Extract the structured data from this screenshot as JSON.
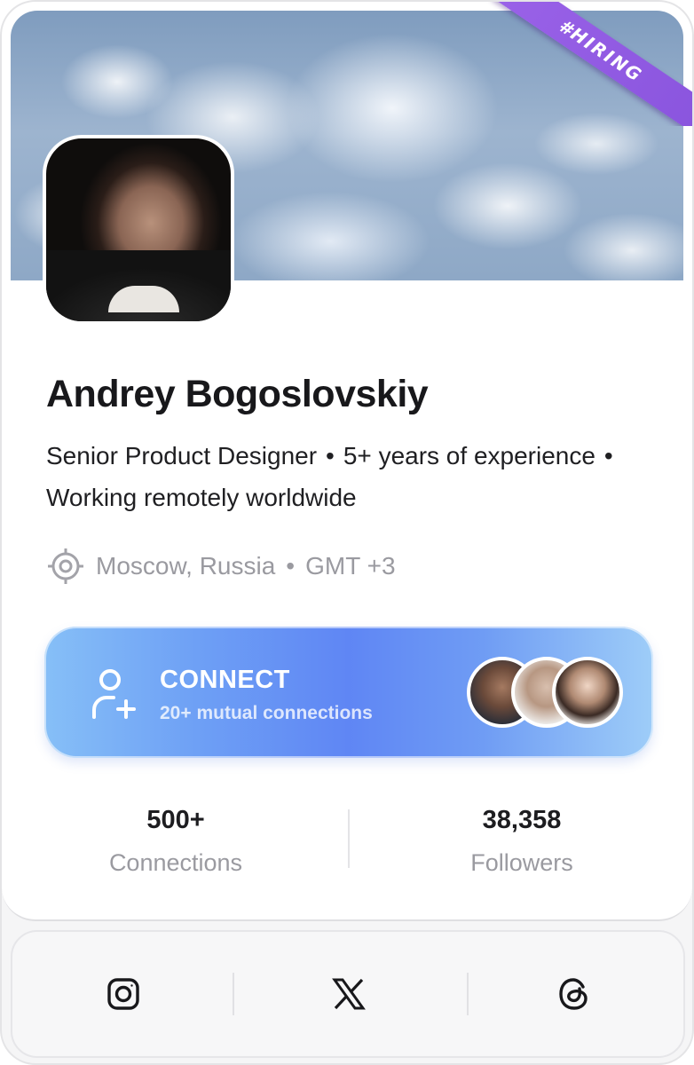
{
  "profile": {
    "name": "Andrey Bogoslovskiy",
    "badge": "#HIRING",
    "bio_line1_part1": "Senior Product Designer",
    "bio_line1_part2": "5+ years of experience",
    "bio_line2": "Working remotely worldwide",
    "separator": "•",
    "location": "Moscow, Russia",
    "timezone": "GMT +3"
  },
  "connect": {
    "label": "CONNECT",
    "mutual": "20+ mutual connections"
  },
  "stats": [
    {
      "value": "500+",
      "label": "Connections"
    },
    {
      "value": "38,358",
      "label": "Followers"
    }
  ],
  "social": [
    "instagram-icon",
    "x-icon",
    "threads-icon"
  ],
  "colors": {
    "badge": "#9a62e8",
    "connect_start": "#86bff7",
    "connect_mid": "#5f86f4",
    "connect_end": "#9ecdf8",
    "muted_text": "#9a9aa0"
  }
}
